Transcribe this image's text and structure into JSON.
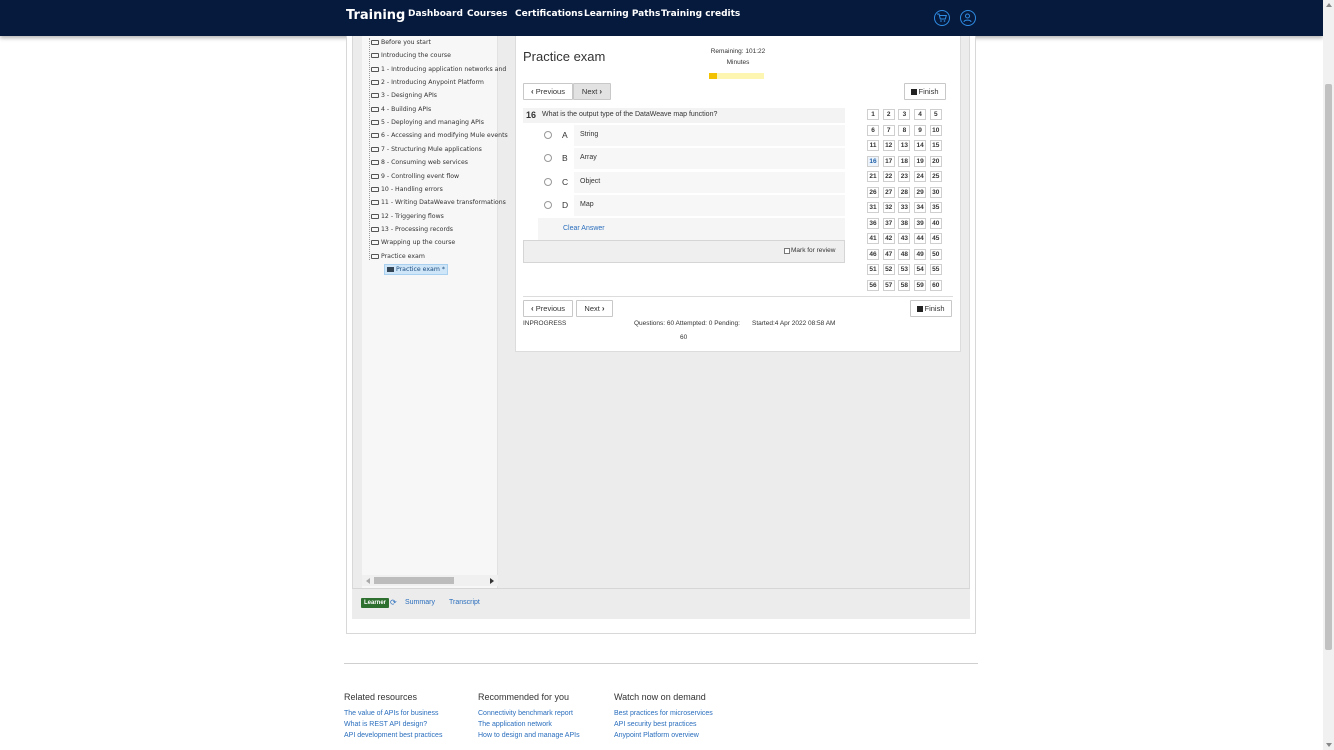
{
  "nav": {
    "brand": "Training",
    "links": [
      "Dashboard",
      "Courses",
      "Certifications",
      "Learning Paths",
      "Training credits"
    ],
    "icons": [
      "cart-icon",
      "user-icon"
    ],
    "bg_color": "#061a3e"
  },
  "tree": {
    "items": [
      "Before you start",
      "Introducing the course",
      "1 - Introducing application networks and",
      "2 - Introducing Anypoint Platform",
      "3 - Designing APIs",
      "4 - Building APIs",
      "5 - Deploying and managing APIs",
      "6 - Accessing and modifying Mule events",
      "7 - Structuring Mule applications",
      "8 - Consuming web services",
      "9 - Controlling event flow",
      "10 - Handling errors",
      "11 - Writing DataWeave transformations",
      "12 - Triggering flows",
      "13 - Processing records",
      "Wrapping up the course",
      "Practice exam"
    ],
    "selected": "Practice exam *"
  },
  "exam": {
    "title": "Practice exam",
    "remaining": "Remaining: 101:22",
    "minutes": "Minutes",
    "time_used_fraction": 0.15,
    "previous": "Previous",
    "next": "Next",
    "finish": "Finish",
    "question": {
      "number": "16",
      "text": "What is the output type of the DataWeave map function?",
      "options": [
        {
          "letter": "A",
          "text": "String"
        },
        {
          "letter": "B",
          "text": "Array"
        },
        {
          "letter": "C",
          "text": "Object"
        },
        {
          "letter": "D",
          "text": "Map"
        }
      ],
      "clear": "Clear Answer",
      "mark_review": "Mark for review"
    },
    "current_question": 16,
    "question_count": 60,
    "status": "INPROGRESS",
    "summary_line1": "Questions: 60 Attempted: 0 Pending:",
    "summary_line2": "60",
    "started": "Started:4 Apr 2022 08:58 AM"
  },
  "tabs": {
    "learner": "Learner",
    "summary": "Summary",
    "transcript": "Transcript"
  },
  "footer": {
    "columns": [
      {
        "heading": "Related resources",
        "links": [
          "The value of APIs for business",
          "What is REST API design?",
          "API development best practices"
        ]
      },
      {
        "heading": "Recommended for you",
        "links": [
          "Connectivity benchmark report",
          "The application network",
          "How to design and manage APIs"
        ]
      },
      {
        "heading": "Watch now on demand",
        "links": [
          "Best practices for microservices",
          "API security best practices",
          "Anypoint Platform overview"
        ]
      }
    ]
  }
}
